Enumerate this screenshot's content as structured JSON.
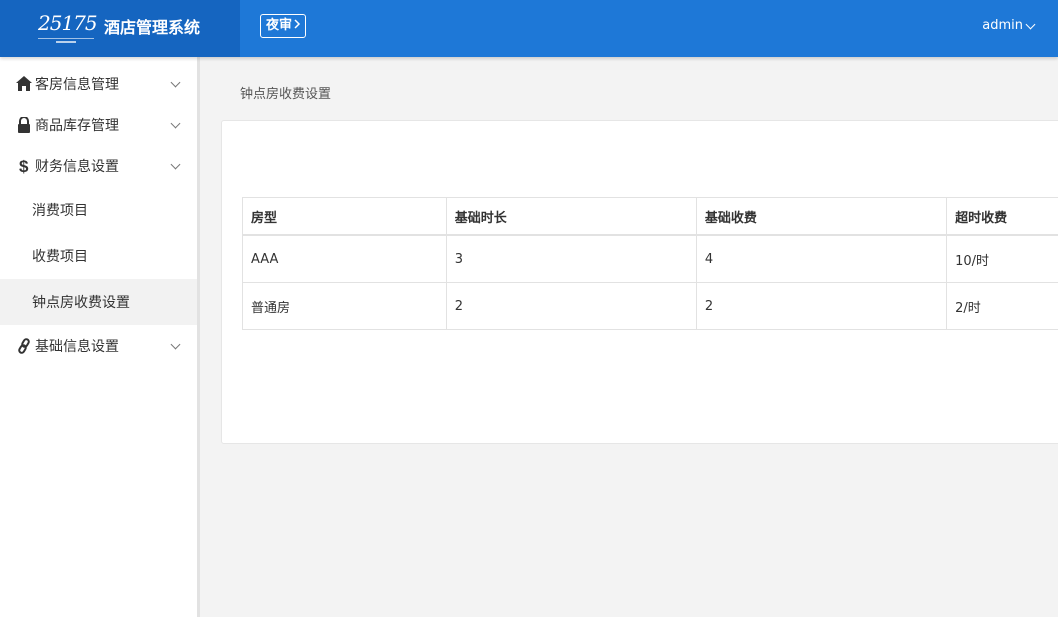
{
  "header": {
    "logo_text": "25175",
    "app_title": "酒店管理系统",
    "night_audit_label": "夜审",
    "user_label": "admin"
  },
  "sidebar": {
    "items": [
      {
        "label": "客房信息管理",
        "icon": "home-icon"
      },
      {
        "label": "商品库存管理",
        "icon": "lock-icon"
      },
      {
        "label": "财务信息设置",
        "icon": "dollar-icon"
      },
      {
        "label": "基础信息设置",
        "icon": "link-icon"
      }
    ],
    "sub_items": [
      {
        "label": "消费项目"
      },
      {
        "label": "收费项目"
      },
      {
        "label": "钟点房收费设置",
        "active": true
      }
    ]
  },
  "breadcrumb": "钟点房收费设置",
  "table": {
    "headers": [
      "房型",
      "基础时长",
      "基础收费",
      "超时收费"
    ],
    "rows": [
      [
        "AAA",
        "3",
        "4",
        "10/时"
      ],
      [
        "普通房",
        "2",
        "2",
        "2/时"
      ]
    ]
  },
  "colors": {
    "topbar": "#1e78d7",
    "brand": "#1565c0",
    "sidebar_active": "#f2f2f2"
  }
}
